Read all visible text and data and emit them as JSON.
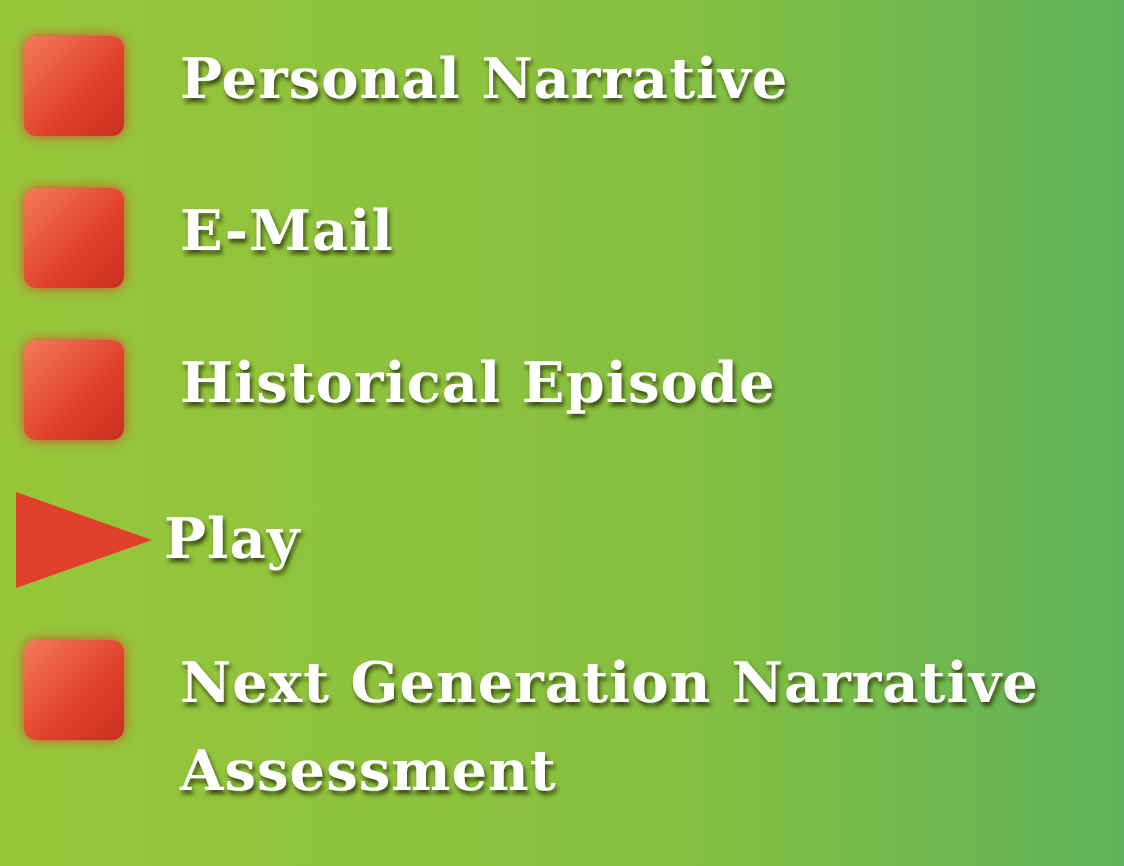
{
  "menu": [
    {
      "kind": "square",
      "label": "Personal Narrative"
    },
    {
      "kind": "square",
      "label": "E-Mail"
    },
    {
      "kind": "square",
      "label": "Historical Episode"
    },
    {
      "kind": "arrow",
      "label": "Play"
    },
    {
      "kind": "square",
      "label": "Next Generation Narrative Assessment"
    }
  ]
}
